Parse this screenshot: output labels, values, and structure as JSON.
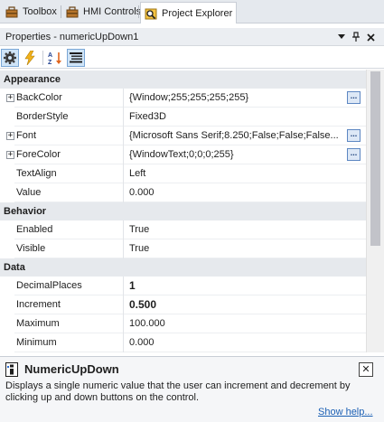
{
  "tabs": [
    {
      "label": "Toolbox",
      "icon": "toolbox-icon",
      "active": false
    },
    {
      "label": "HMI Controls",
      "icon": "hmi-controls-icon",
      "active": false
    },
    {
      "label": "Project Explorer",
      "icon": "project-explorer-icon",
      "active": true
    }
  ],
  "panel": {
    "title": "Properties - numericUpDown1",
    "dropdown_icon": "dropdown-arrow-icon",
    "pin_icon": "pin-icon",
    "close_icon": "close-icon"
  },
  "toolbar": {
    "buttons": [
      {
        "icon": "properties-gear-icon",
        "pressed": true
      },
      {
        "icon": "events-lightning-icon",
        "pressed": false
      },
      {
        "icon": "sort-alphabetical-icon",
        "pressed": false
      },
      {
        "icon": "categorized-list-icon",
        "pressed": true
      }
    ]
  },
  "categories": [
    {
      "name": "Appearance",
      "properties": [
        {
          "name": "BackColor",
          "value": "{Window;255;255;255;255}",
          "expandable": true,
          "ellipsis": true,
          "bold": false
        },
        {
          "name": "BorderStyle",
          "value": "Fixed3D",
          "expandable": false,
          "ellipsis": false,
          "bold": false
        },
        {
          "name": "Font",
          "value": "{Microsoft Sans Serif;8.250;False;False;False...",
          "expandable": true,
          "ellipsis": true,
          "bold": false
        },
        {
          "name": "ForeColor",
          "value": "{WindowText;0;0;0;255}",
          "expandable": true,
          "ellipsis": true,
          "bold": false
        },
        {
          "name": "TextAlign",
          "value": "Left",
          "expandable": false,
          "ellipsis": false,
          "bold": false
        },
        {
          "name": "Value",
          "value": "0.000",
          "expandable": false,
          "ellipsis": false,
          "bold": false
        }
      ]
    },
    {
      "name": "Behavior",
      "properties": [
        {
          "name": "Enabled",
          "value": "True",
          "expandable": false,
          "ellipsis": false,
          "bold": false
        },
        {
          "name": "Visible",
          "value": "True",
          "expandable": false,
          "ellipsis": false,
          "bold": false
        }
      ]
    },
    {
      "name": "Data",
      "properties": [
        {
          "name": "DecimalPlaces",
          "value": "1",
          "expandable": false,
          "ellipsis": false,
          "bold": true
        },
        {
          "name": "Increment",
          "value": "0.500",
          "expandable": false,
          "ellipsis": false,
          "bold": true
        },
        {
          "name": "Maximum",
          "value": "100.000",
          "expandable": false,
          "ellipsis": false,
          "bold": false
        },
        {
          "name": "Minimum",
          "value": "0.000",
          "expandable": false,
          "ellipsis": false,
          "bold": false
        }
      ]
    }
  ],
  "ellipsis_label": "...",
  "expander_label": "+",
  "help": {
    "title": "NumericUpDown",
    "description": "Displays a single numeric value that the user can increment and decrement by clicking up and down buttons on the control.",
    "link": "Show help...",
    "close_label": "✕",
    "icon": "help-category-icon"
  },
  "colors": {
    "accent_blue": "#1a5fb4",
    "category_bg": "#e6e9ed",
    "tab_strip_bg": "#e5e9ee"
  }
}
